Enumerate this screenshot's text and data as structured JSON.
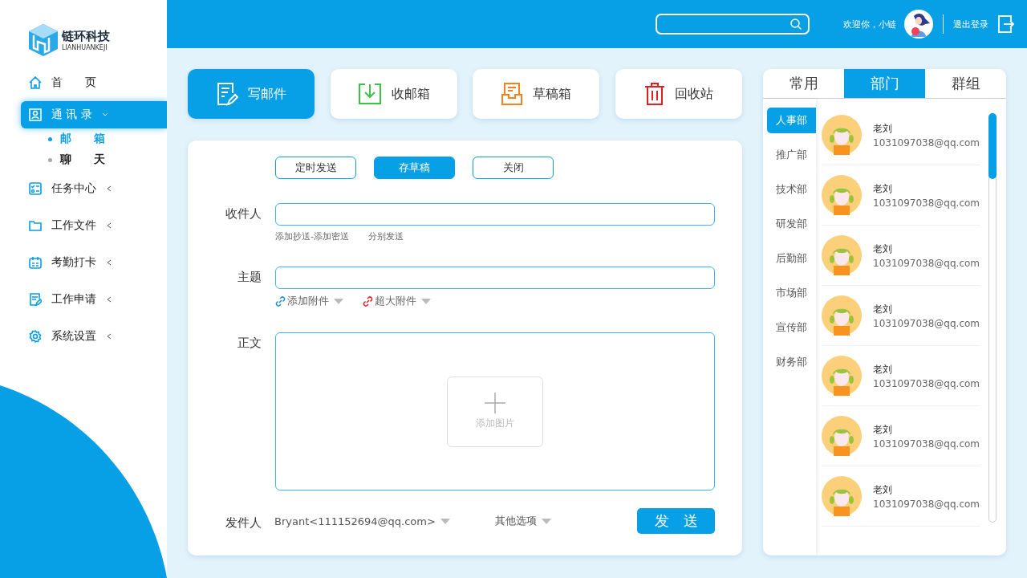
{
  "logo": {
    "name": "链环科技",
    "subtitle": "LIANHUANKEJI"
  },
  "sidebar": {
    "items": [
      {
        "label": "首　　页",
        "selected": false
      },
      {
        "label": "通 讯 录",
        "selected": true,
        "expanded": true,
        "children": [
          {
            "label": "邮　　箱",
            "selected": true
          },
          {
            "label": "聊　　天",
            "selected": false
          }
        ]
      },
      {
        "label": "任务中心",
        "selected": false,
        "expanded": false
      },
      {
        "label": "工作文件",
        "selected": false,
        "expanded": false
      },
      {
        "label": "考勤打卡",
        "selected": false,
        "expanded": false
      },
      {
        "label": "工作申请",
        "selected": false,
        "expanded": false
      },
      {
        "label": "系统设置",
        "selected": false,
        "expanded": false
      }
    ]
  },
  "header": {
    "welcome": "欢迎你，小链",
    "logout": "退出登录"
  },
  "toolbar": [
    {
      "label": "写邮件",
      "selected": true
    },
    {
      "label": "收邮箱",
      "selected": false
    },
    {
      "label": "草稿箱",
      "selected": false
    },
    {
      "label": "回收站",
      "selected": false
    }
  ],
  "compose": {
    "actions": [
      {
        "label": "定时发送",
        "selected": false
      },
      {
        "label": "存草稿",
        "selected": true
      },
      {
        "label": "关闭",
        "selected": false
      }
    ],
    "recipient": {
      "label": "收件人",
      "links": [
        "添加抄送-添加密送",
        "分别发送"
      ]
    },
    "subject": {
      "label": "主题",
      "attachments": [
        {
          "label": "添加附件",
          "color": "#1e8fe0"
        },
        {
          "label": "超大附件",
          "color": "#e02020"
        }
      ]
    },
    "body": {
      "label": "正文",
      "add_image": "添加图片"
    },
    "sender": {
      "label": "发件人",
      "value": "Bryant<111152694@qq.com>",
      "other": "其他选项",
      "send": "发　送"
    }
  },
  "contacts": {
    "tabs": [
      {
        "label": "常用",
        "selected": false
      },
      {
        "label": "部门",
        "selected": true
      },
      {
        "label": "群组",
        "selected": false
      }
    ],
    "departments": [
      {
        "label": "人事部",
        "selected": true
      },
      {
        "label": "推广部",
        "selected": false
      },
      {
        "label": "技术部",
        "selected": false
      },
      {
        "label": "研发部",
        "selected": false
      },
      {
        "label": "后勤部",
        "selected": false
      },
      {
        "label": "市场部",
        "selected": false
      },
      {
        "label": "宣传部",
        "selected": false
      },
      {
        "label": "财务部",
        "selected": false
      }
    ],
    "people": [
      {
        "name": "老刘",
        "email": "1031097038@qq.com"
      },
      {
        "name": "老刘",
        "email": "1031097038@qq.com"
      },
      {
        "name": "老刘",
        "email": "1031097038@qq.com"
      },
      {
        "name": "老刘",
        "email": "1031097038@qq.com"
      },
      {
        "name": "老刘",
        "email": "1031097038@qq.com"
      },
      {
        "name": "老刘",
        "email": "1031097038@qq.com"
      },
      {
        "name": "老刘",
        "email": "1031097038@qq.com"
      }
    ]
  }
}
